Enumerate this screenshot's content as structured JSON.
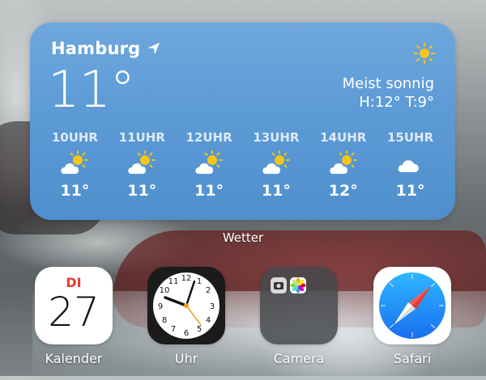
{
  "weather": {
    "city": "Hamburg",
    "temperature": "11°",
    "condition": "Meist sonnig",
    "high_low": "H:12° T:9°",
    "hourly": [
      {
        "label": "10UHR",
        "temp": "11°",
        "icon": "partly-sunny-icon"
      },
      {
        "label": "11UHR",
        "temp": "11°",
        "icon": "partly-sunny-icon"
      },
      {
        "label": "12UHR",
        "temp": "11°",
        "icon": "partly-sunny-icon"
      },
      {
        "label": "13UHR",
        "temp": "11°",
        "icon": "partly-sunny-icon"
      },
      {
        "label": "14UHR",
        "temp": "12°",
        "icon": "partly-sunny-icon"
      },
      {
        "label": "15UHR",
        "temp": "11°",
        "icon": "cloud-icon"
      }
    ],
    "widget_label": "Wetter"
  },
  "apps": [
    {
      "label": "Kalender",
      "icon": "calendar-icon",
      "day": "DI",
      "date": "27"
    },
    {
      "label": "Uhr",
      "icon": "clock-icon"
    },
    {
      "label": "Camera",
      "icon": "folder-icon"
    },
    {
      "label": "Safari",
      "icon": "compass-icon"
    }
  ],
  "colors": {
    "widget_blue": "#5d9bd6",
    "sun_yellow": "#f5c518",
    "calendar_red": "#e53b30",
    "clock_second_hand": "#f39c12",
    "safari_blue": "#1e90ff"
  }
}
